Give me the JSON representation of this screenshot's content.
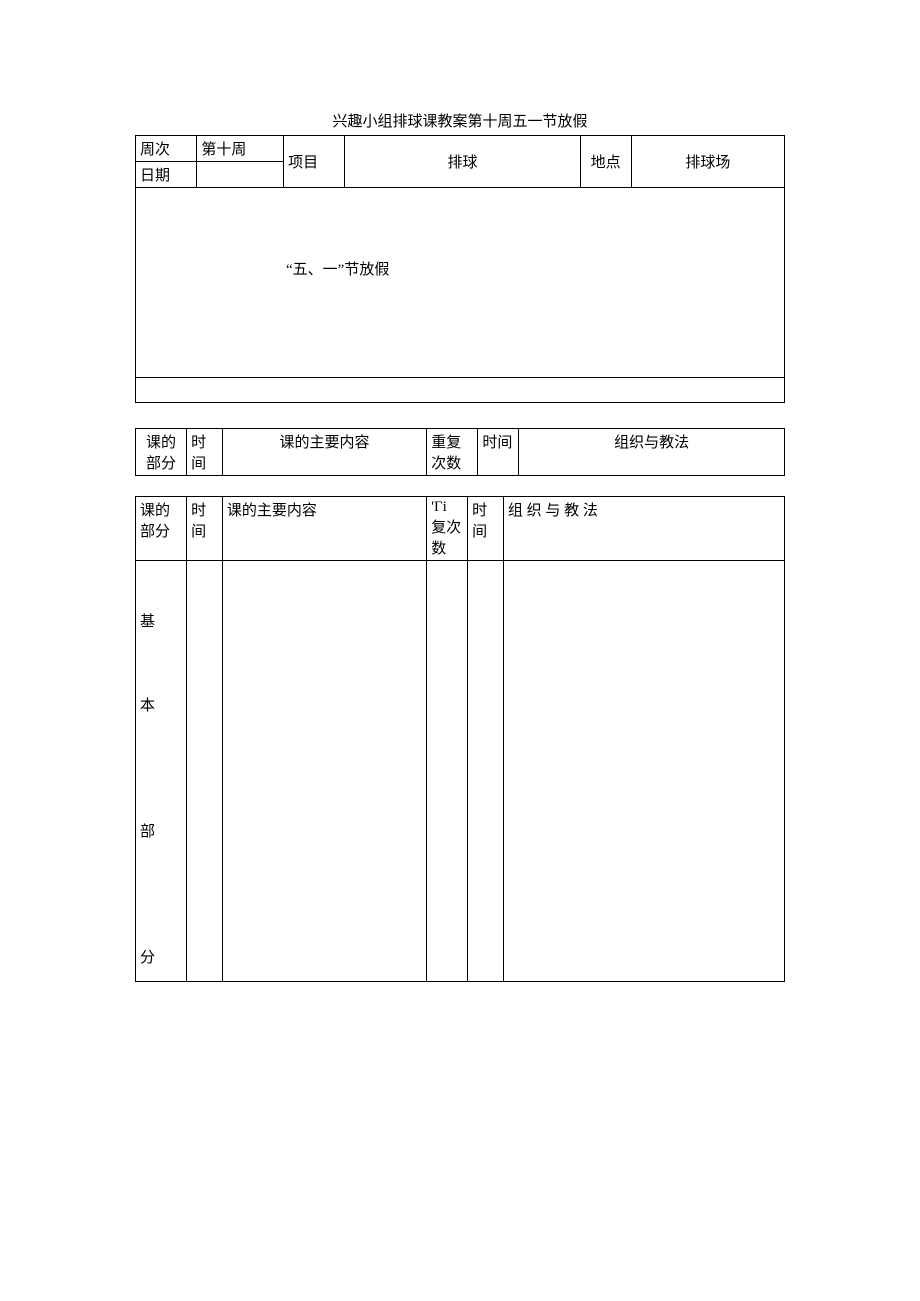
{
  "title": "兴趣小组排球课教案第十周五一节放假",
  "table1": {
    "row1_label": "周次",
    "row1_value": "第十周",
    "row2_label": "日期",
    "row2_value": "",
    "item_label": "项目",
    "item_value": "排球",
    "place_label": "地点",
    "place_value": "排球场",
    "holiday_text": "“五、一”节放假"
  },
  "table2": {
    "col1": "课的部分",
    "col2": "时间",
    "col3": "课的主要内容",
    "col4": "重复次数",
    "col5": "时间",
    "col6": "组织与教法"
  },
  "table3": {
    "col1": "课的部分",
    "col2": "时间",
    "col3": "课的主要内容",
    "col4": "'Гi 复次数",
    "col5": "时间",
    "col6": "组 织 与 教 法",
    "section_label": "基 本 部 分"
  }
}
